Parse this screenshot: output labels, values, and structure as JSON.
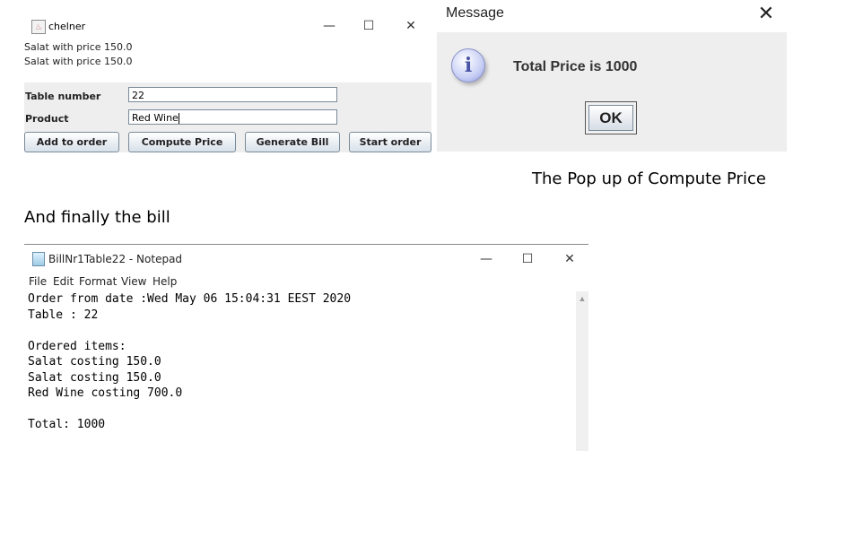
{
  "chelner_window": {
    "title": "chelner",
    "controls": {
      "minimize": "—",
      "maximize": "☐",
      "close": "✕"
    },
    "order_lines": [
      "Salat with price 150.0",
      "Salat with price 150.0"
    ],
    "table_number_label": "Table number",
    "table_number_value": "22",
    "product_label": "Product",
    "product_value": "Red Wine",
    "buttons": {
      "add_to_order": "Add to order",
      "compute_price": "Compute Price",
      "generate_bill": "Generate Bill",
      "start_order": "Start order"
    }
  },
  "message_dialog": {
    "title": "Message",
    "close": "✕",
    "icon": "info-icon",
    "icon_glyph": "i",
    "text": "Total Price is 1000",
    "ok_label": "OK"
  },
  "captions": {
    "popup": "The Pop up of Compute Price",
    "bill": "And finally the bill"
  },
  "notepad_window": {
    "title": "BillNr1Table22 - Notepad",
    "controls": {
      "minimize": "—",
      "maximize": "☐",
      "close": "✕"
    },
    "menu": [
      "File",
      "Edit",
      "Format",
      "View",
      "Help"
    ],
    "lines": [
      "Order from date :Wed May 06 15:04:31 EEST 2020",
      "Table : 22",
      "",
      "Ordered items:",
      "Salat costing 150.0",
      "Salat costing 150.0",
      "Red Wine costing 700.0",
      "",
      "Total: 1000"
    ],
    "scroll_up": "▲"
  }
}
